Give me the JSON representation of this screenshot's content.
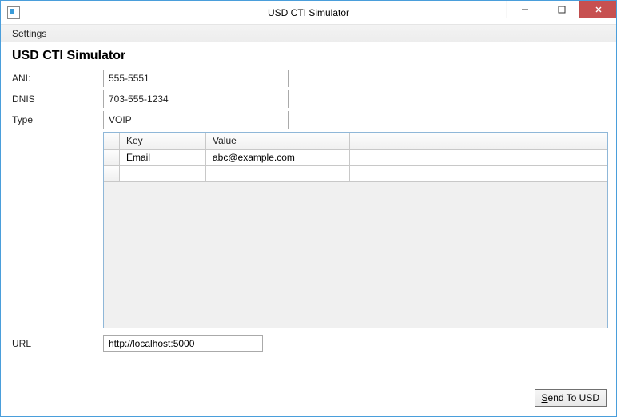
{
  "window": {
    "title": "USD CTI Simulator"
  },
  "menu": {
    "settings": "Settings"
  },
  "heading": "USD CTI Simulator",
  "fields": {
    "ani": {
      "label": "ANI:",
      "value": "555-5551"
    },
    "dnis": {
      "label": "DNIS",
      "value": "703-555-1234"
    },
    "type": {
      "label": "Type",
      "value": "VOIP"
    },
    "url": {
      "label": "URL",
      "value": "http://localhost:5000"
    }
  },
  "grid": {
    "headers": {
      "key": "Key",
      "value": "Value"
    },
    "rows": [
      {
        "key": "Email",
        "value": "abc@example.com"
      }
    ]
  },
  "buttons": {
    "send": "Send To USD"
  }
}
